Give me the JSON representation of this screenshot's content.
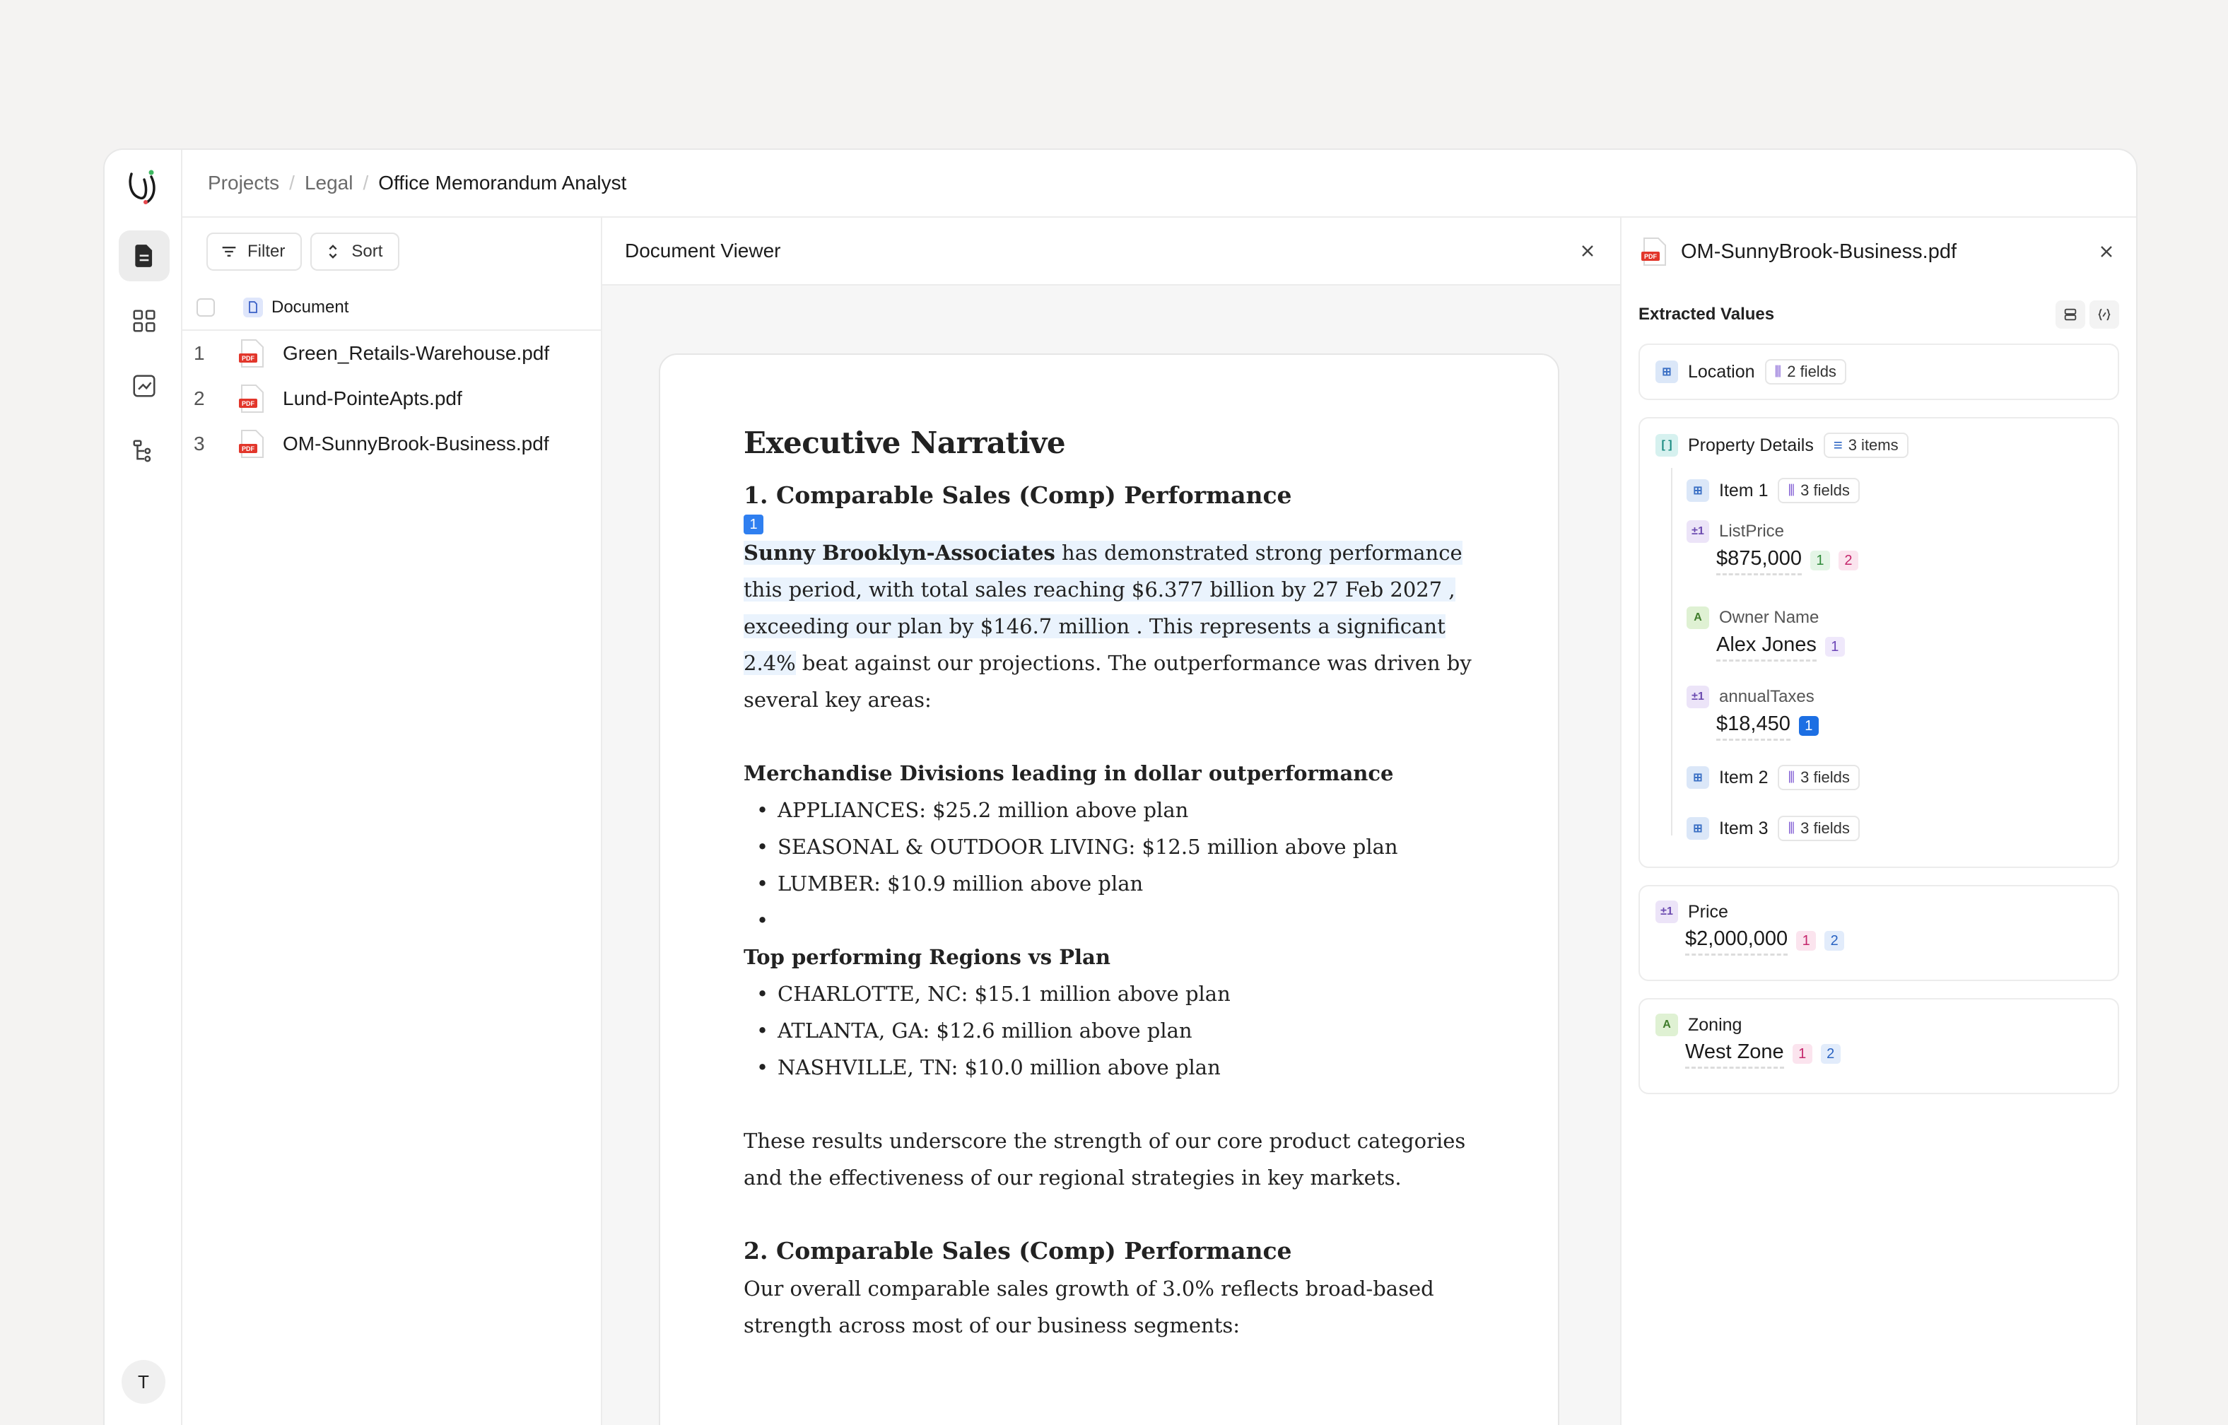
{
  "breadcrumb": [
    "Projects",
    "Legal",
    "Office Memorandum Analyst"
  ],
  "user_initial": "T",
  "list": {
    "filter_label": "Filter",
    "sort_label": "Sort",
    "column_header": "Document",
    "rows": [
      {
        "num": "1",
        "name": "Green_Retails-Warehouse.pdf"
      },
      {
        "num": "2",
        "name": "Lund-PointeApts.pdf"
      },
      {
        "num": "3",
        "name": "OM-SunnyBrook-Business.pdf"
      }
    ]
  },
  "viewer": {
    "title": "Document Viewer",
    "heading": "Executive Narrative",
    "section1_title": "1. Comparable Sales (Comp) Performance",
    "citation": "1",
    "para1_bold": "Sunny Brooklyn-Associates",
    "para1_hl1": " has demonstrated strong performance this period, with total  sales reaching $6.377 billion by 27 Feb 2027 , exceeding our plan by $146.7 million . This represents a significant 2.4%",
    "para1_rest": " beat against our projections. The outperformance was driven by several key areas:",
    "sub1": "Merchandise Divisions leading in dollar outperformance",
    "bullets1": [
      "APPLIANCES: $25.2 million above plan",
      "SEASONAL & OUTDOOR LIVING: $12.5 million above plan",
      "LUMBER: $10.9 million above plan",
      ""
    ],
    "sub2": "Top performing Regions vs Plan",
    "bullets2": [
      "CHARLOTTE, NC: $15.1 million above plan",
      "ATLANTA, GA: $12.6 million above plan",
      "NASHVILLE, TN: $10.0 million above plan"
    ],
    "para2": "These results underscore the strength of our core product categories and the effectiveness of our regional strategies in key markets.",
    "section2_title": "2. Comparable Sales (Comp) Performance",
    "para3": "Our overall comparable sales growth of 3.0%  reflects broad-based strength across most of our business segments:"
  },
  "panel": {
    "file_name": "OM-SunnyBrook-Business.pdf",
    "section_title": "Extracted Values",
    "location": {
      "label": "Location",
      "chip": "2 fields"
    },
    "property": {
      "label": "Property Details",
      "chip": "3 items",
      "item1": {
        "label": "Item 1",
        "chip": "3 fields"
      },
      "list_price": {
        "label": "ListPrice",
        "value": "$875,000",
        "refs": [
          "1",
          "2"
        ]
      },
      "owner": {
        "label": "Owner Name",
        "value": "Alex Jones",
        "refs": [
          "1"
        ]
      },
      "taxes": {
        "label": "annualTaxes",
        "value": "$18,450",
        "refs": [
          "1"
        ]
      },
      "item2": {
        "label": "Item 2",
        "chip": "3 fields"
      },
      "item3": {
        "label": "Item 3",
        "chip": "3 fields"
      }
    },
    "price": {
      "label": "Price",
      "value": "$2,000,000",
      "refs": [
        "1",
        "2"
      ]
    },
    "zoning": {
      "label": "Zoning",
      "value": "West Zone",
      "refs": [
        "1",
        "2"
      ]
    }
  }
}
